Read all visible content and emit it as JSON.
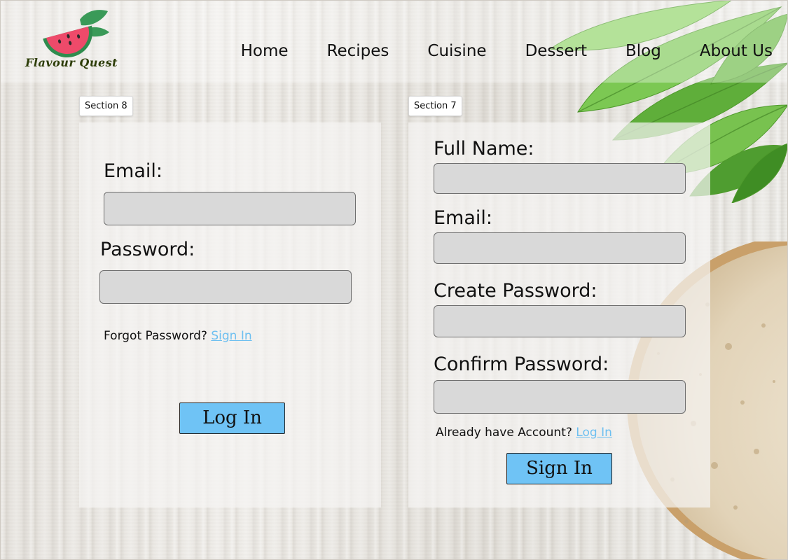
{
  "brand": {
    "name": "Flavour Quest"
  },
  "nav": {
    "items": [
      {
        "label": "Home"
      },
      {
        "label": "Recipes"
      },
      {
        "label": "Cuisine"
      },
      {
        "label": "Dessert"
      },
      {
        "label": "Blog"
      },
      {
        "label": "About Us"
      }
    ]
  },
  "login": {
    "section_tag": "Section 8",
    "email_label": "Email:",
    "email_value": "",
    "password_label": "Password:",
    "password_value": "",
    "forgot_text": "Forgot Password?",
    "forgot_link": "Sign In",
    "submit_label": "Log In"
  },
  "signup": {
    "section_tag": "Section 7",
    "fullname_label": "Full Name:",
    "email_label": "Email:",
    "create_password_label": "Create Password:",
    "confirm_password_label": "Confirm Password:",
    "account_text": "Already have Account?",
    "account_link": "Log In",
    "submit_label": "Sign In"
  },
  "colors": {
    "button": "#6fc3f5",
    "link": "#6dbff0",
    "field": "#d9d9d9",
    "logo_fruit": "#ee4a6a",
    "logo_leaf": "#3a9a58"
  },
  "icons": [
    "watermelon-logo-icon"
  ]
}
